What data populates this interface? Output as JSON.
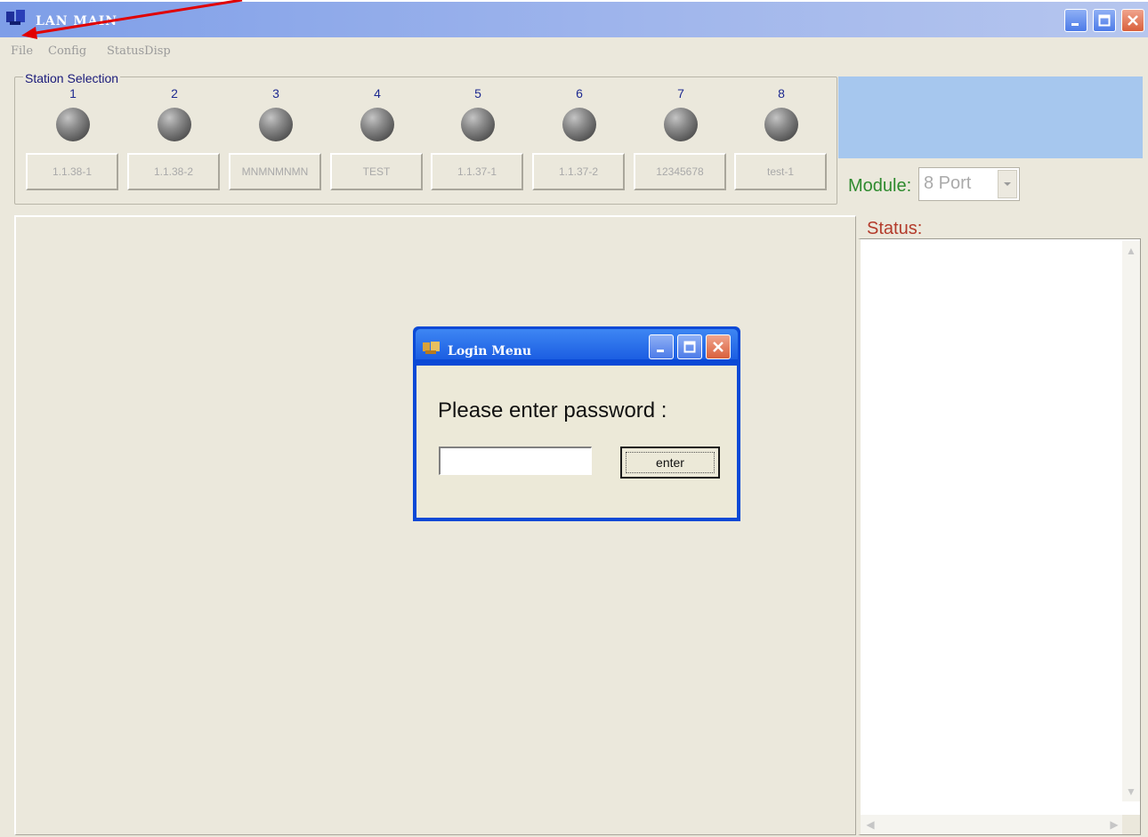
{
  "window": {
    "title": "LAN MAIN"
  },
  "menu": {
    "items": [
      "File",
      "Config",
      "StatusDisp"
    ]
  },
  "station_selection": {
    "title": "Station Selection",
    "stations": [
      {
        "number": "1",
        "name": "1.1.38-1"
      },
      {
        "number": "2",
        "name": "1.1.38-2"
      },
      {
        "number": "3",
        "name": "MNMNMNMN"
      },
      {
        "number": "4",
        "name": "TEST"
      },
      {
        "number": "5",
        "name": "1.1.37-1"
      },
      {
        "number": "6",
        "name": "1.1.37-2"
      },
      {
        "number": "7",
        "name": "12345678"
      },
      {
        "number": "8",
        "name": "test-1"
      }
    ]
  },
  "module": {
    "label": "Module:",
    "value": "8 Port"
  },
  "status": {
    "label": "Status:"
  },
  "login_dialog": {
    "title": "Login Menu",
    "prompt": "Please enter password :",
    "password_value": "",
    "enter_label": "enter"
  },
  "colors": {
    "title_bar": "#7e9ee8",
    "dialog_frame": "#0a49d6",
    "annotation_arrow": "#e00000",
    "module_label": "#2e8a2e",
    "status_label": "#b33a2a"
  }
}
